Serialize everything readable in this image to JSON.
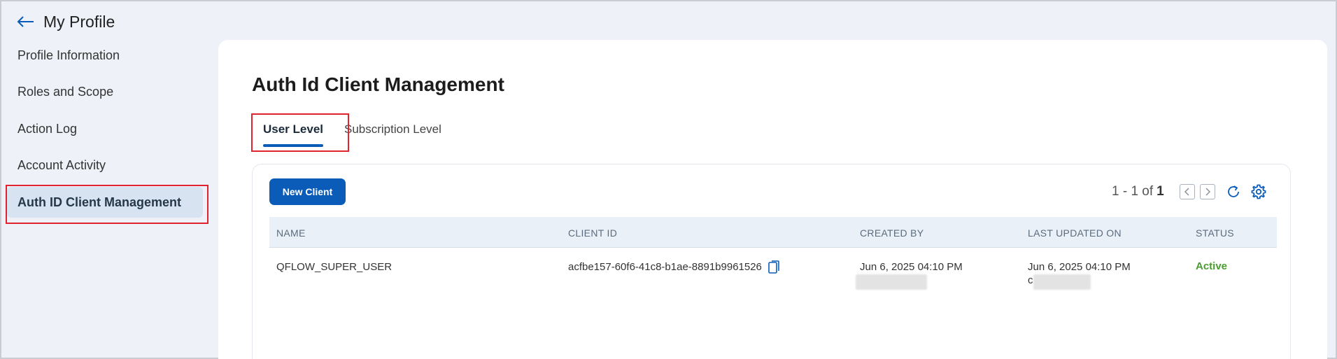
{
  "header": {
    "title": "My Profile",
    "back_icon": "arrow-left-icon"
  },
  "sidebar": {
    "items": [
      {
        "label": "Profile Information",
        "active": false
      },
      {
        "label": "Roles and Scope",
        "active": false
      },
      {
        "label": "Action Log",
        "active": false
      },
      {
        "label": "Account Activity",
        "active": false
      },
      {
        "label": "Auth ID Client Management",
        "active": true
      }
    ]
  },
  "main": {
    "title": "Auth Id Client Management",
    "tabs": [
      {
        "label": "User Level",
        "selected": true
      },
      {
        "label": "Subscription Level",
        "selected": false
      }
    ],
    "new_client_label": "New Client",
    "pagination": {
      "range": "1 - 1 of",
      "total": "1"
    },
    "table": {
      "columns": [
        "NAME",
        "CLIENT ID",
        "CREATED BY",
        "LAST UPDATED ON",
        "STATUS"
      ],
      "rows": [
        {
          "name": "QFLOW_SUPER_USER",
          "client_id": "acfbe157-60f6-41c8-b1ae-8891b9961526",
          "created_by": "Jun 6, 2025 04:10 PM",
          "last_updated_on": "Jun 6, 2025 04:10 PM",
          "last_updated_by_initial": "c",
          "status": "Active"
        }
      ]
    }
  },
  "colors": {
    "accent": "#0b5cb8",
    "status_active": "#4a9c2f",
    "highlight": "#e0232f",
    "sidebar_active_bg": "#d7e3f1"
  }
}
